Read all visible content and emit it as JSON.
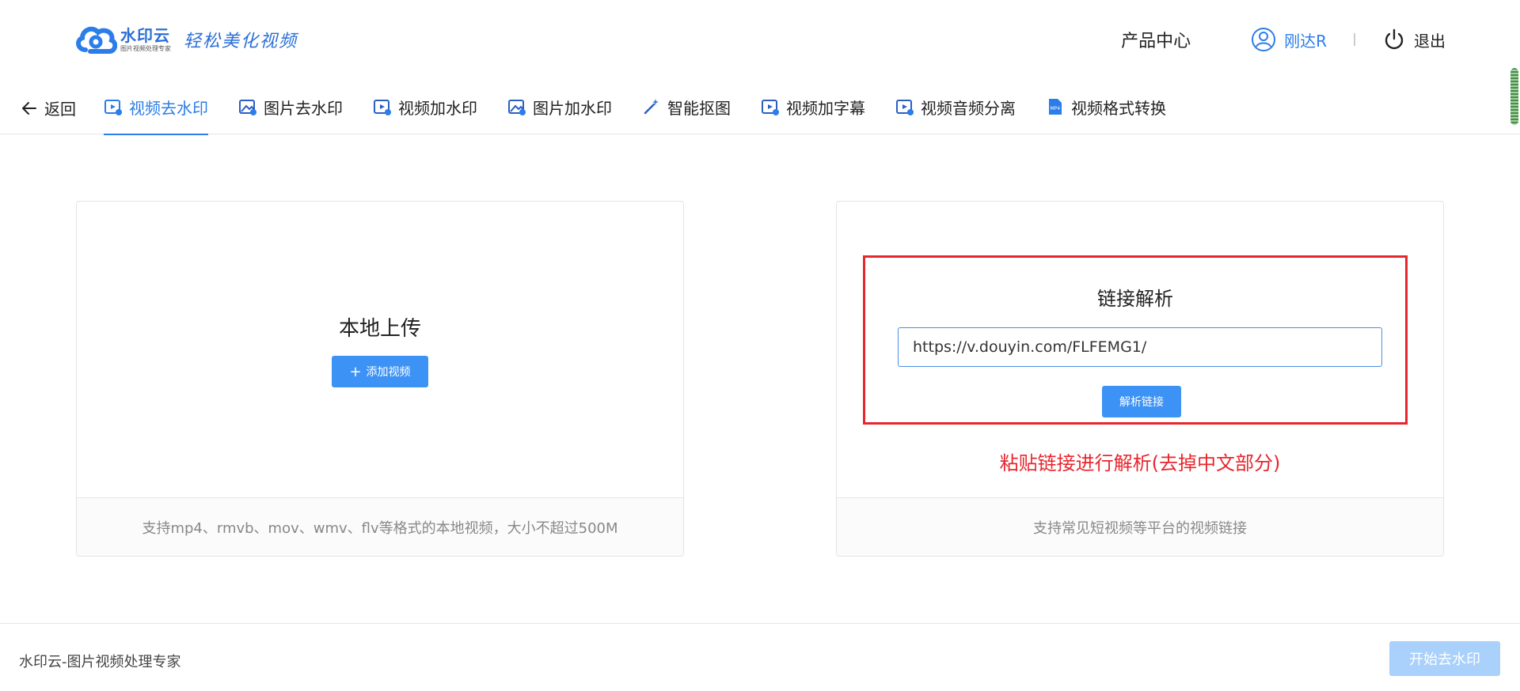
{
  "header": {
    "logo_name": "水印云",
    "logo_sub": "图片视频处理专家",
    "slogan": "轻松美化视频",
    "product_center": "产品中心",
    "username": "刚达R",
    "logout": "退出"
  },
  "nav": {
    "back": "返回",
    "tabs": [
      {
        "label": "视频去水印",
        "icon": "video-icon",
        "active": true
      },
      {
        "label": "图片去水印",
        "icon": "image-icon"
      },
      {
        "label": "视频加水印",
        "icon": "video-add-icon"
      },
      {
        "label": "图片加水印",
        "icon": "image-add-icon"
      },
      {
        "label": "智能抠图",
        "icon": "magic-wand-icon"
      },
      {
        "label": "视频加字幕",
        "icon": "video-text-icon"
      },
      {
        "label": "视频音频分离",
        "icon": "video-audio-icon"
      },
      {
        "label": "视频格式转换",
        "icon": "mp4-file-icon"
      }
    ]
  },
  "local_upload": {
    "title": "本地上传",
    "add_button": "添加视频",
    "footer": "支持mp4、rmvb、mov、wmv、flv等格式的本地视频，大小不超过500M"
  },
  "link_parse": {
    "title": "链接解析",
    "url_value": "https://v.douyin.com/FLFEMG1/",
    "parse_button": "解析链接",
    "annotation": "粘贴链接进行解析(去掉中文部分)",
    "footer": "支持常见短视频等平台的视频链接"
  },
  "footer": {
    "brand": "水印云-图片视频处理专家",
    "start_button": "开始去水印"
  },
  "colors": {
    "accent": "#2b7de9",
    "button": "#3d93f5",
    "button_disabled": "#a9d1fb",
    "annotation_red": "#e8262d"
  }
}
